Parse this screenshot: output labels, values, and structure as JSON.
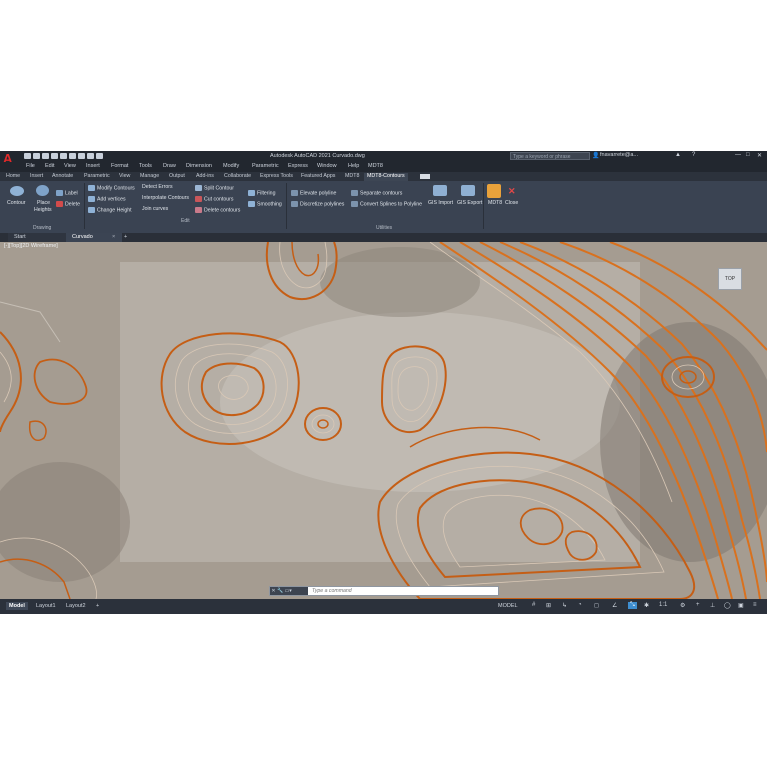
{
  "window": {
    "title": "Autodesk AutoCAD 2021   Curvado.dwg",
    "search_placeholder": "Type a keyword or phrase",
    "user": "fnavarrete@a...",
    "controls": [
      "—",
      "□",
      "✕"
    ]
  },
  "menu": [
    "File",
    "Edit",
    "View",
    "Insert",
    "Format",
    "Tools",
    "Draw",
    "Dimension",
    "Modify",
    "Parametric",
    "Express",
    "Window",
    "Help",
    "MDT8"
  ],
  "ribbon_tabs": [
    "Home",
    "Insert",
    "Annotate",
    "Parametric",
    "View",
    "Manage",
    "Output",
    "Add-ins",
    "Collaborate",
    "Express Tools",
    "Featured Apps",
    "MDT8",
    "MDT8-Contours"
  ],
  "ribbon_active_tab": "MDT8-Contours",
  "ribbon": {
    "drawing": {
      "name": "Drawing",
      "contour": "Contour",
      "place": "Place",
      "heights": "Heights",
      "label": "Label",
      "delete": "Delete"
    },
    "edit": {
      "name": "Edit",
      "modify_contours": "Modify Contours",
      "add_vertices": "Add vertices",
      "change_height": "Change Height",
      "detect_errors": "Detect Errors",
      "interpolate_contours": "Interpolate Contours",
      "join_curves": "Join curves",
      "split_contour": "Split Contour",
      "cut_contours": "Cut contours",
      "delete_contours": "Delete contours",
      "filtering": "Filtering",
      "smoothing": "Smoothing"
    },
    "utilities": {
      "name": "Utilities",
      "elevate_polyline": "Elevate polyline",
      "discretize_polylines": "Discretize polylines",
      "separate_contours": "Separate contours",
      "convert_splines": "Convert Splines to Polyline",
      "gis_import": "GIS Import",
      "gis_export": "GIS Export",
      "mdt8": "MDT8",
      "close": "Close"
    }
  },
  "doc_tabs": [
    "Start",
    "Curvado"
  ],
  "view_label": "[-][Top][2D Wireframe]",
  "viewcube": "TOP",
  "command_placeholder": "Type a command",
  "layout_tabs": [
    "Model",
    "Layout1",
    "Layout2"
  ],
  "status": {
    "model": "MODEL",
    "scale": "1:1"
  },
  "colors": {
    "contour_major": "#d9711e",
    "contour_minor": "#c9b7a3",
    "accent": "#3e8ed0",
    "ui_dark": "#22272f"
  }
}
